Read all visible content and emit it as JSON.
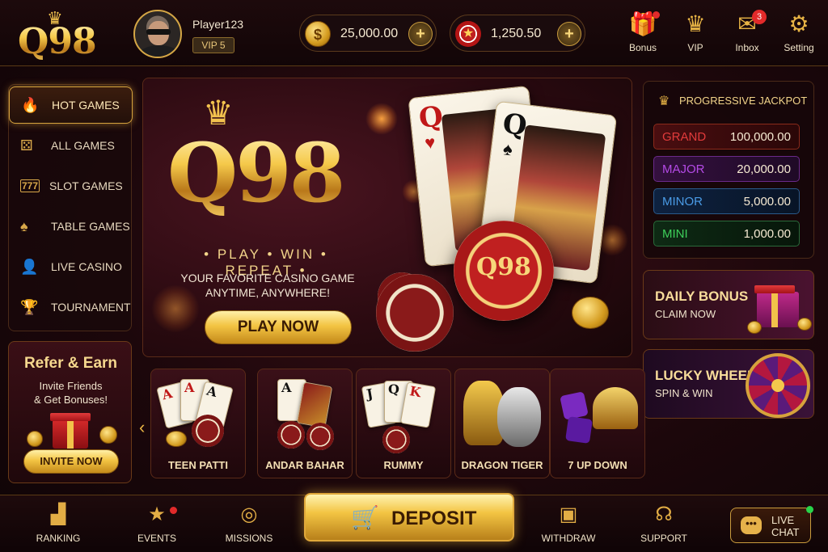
{
  "brand": {
    "logo_text": "Q98"
  },
  "player": {
    "name": "Player123",
    "vip": "VIP 5"
  },
  "wallet": {
    "coins": "25,000.00",
    "chips": "1,250.50",
    "coin_symbol": "$",
    "plus": "+"
  },
  "header_nav": [
    {
      "label": "Bonus",
      "icon": "gift-icon",
      "glyph": "🎁"
    },
    {
      "label": "VIP",
      "icon": "crown-icon",
      "glyph": "♛"
    },
    {
      "label": "Inbox",
      "icon": "mail-icon",
      "glyph": "✉",
      "badge": "3"
    },
    {
      "label": "Setting",
      "icon": "gear-icon",
      "glyph": "⚙"
    }
  ],
  "sidebar": {
    "items": [
      {
        "label": "HOT GAMES",
        "icon": "fire-icon",
        "glyph": "🔥",
        "active": true
      },
      {
        "label": "ALL GAMES",
        "icon": "dice-icon",
        "glyph": "⚄"
      },
      {
        "label": "SLOT GAMES",
        "icon": "slot-777-icon",
        "glyph": "7"
      },
      {
        "label": "TABLE GAMES",
        "icon": "spade-icon",
        "glyph": "♠"
      },
      {
        "label": "LIVE CASINO",
        "icon": "dealer-icon",
        "glyph": "👤"
      },
      {
        "label": "TOURNAMENT",
        "icon": "trophy-icon",
        "glyph": "🏆"
      }
    ]
  },
  "refer": {
    "title": "Refer & Earn",
    "line1": "Invite Friends",
    "line2": "& Get Bonuses!",
    "button": "INVITE NOW"
  },
  "hero": {
    "logo": "Q98",
    "tagline": "• PLAY • WIN • REPEAT •",
    "subtitle_1": "YOUR FAVORITE CASINO GAME",
    "subtitle_2": "ANYTIME, ANYWHERE!",
    "button": "PLAY NOW",
    "card_rank": "Q",
    "chip_text": "Q98"
  },
  "jackpot": {
    "title": "PROGRESSIVE JACKPOT",
    "tiers": [
      {
        "name": "GRAND",
        "value": "100,000.00",
        "color": "#e23b3b"
      },
      {
        "name": "MAJOR",
        "value": "20,000.00",
        "color": "#b44ae6"
      },
      {
        "name": "MINOR",
        "value": "5,000.00",
        "color": "#4a9be6"
      },
      {
        "name": "MINI",
        "value": "1,000.00",
        "color": "#3ecf5a"
      }
    ]
  },
  "promos": {
    "daily": {
      "title": "DAILY BONUS",
      "sub": "CLAIM NOW"
    },
    "wheel": {
      "title": "LUCKY WHEEL",
      "sub": "SPIN & WIN"
    }
  },
  "games": [
    {
      "label": "TEEN PATTI"
    },
    {
      "label": "ANDAR BAHAR"
    },
    {
      "label": "RUMMY"
    },
    {
      "label": "DRAGON TIGER"
    },
    {
      "label": "7 UP DOWN"
    }
  ],
  "bottom_nav": [
    {
      "label": "RANKING",
      "icon": "podium-icon",
      "glyph": "▟"
    },
    {
      "label": "EVENTS",
      "icon": "calendar-star-icon",
      "glyph": "★"
    },
    {
      "label": "MISSIONS",
      "icon": "target-icon",
      "glyph": "◎"
    },
    {
      "label": "WITHDRAW",
      "icon": "wallet-icon",
      "glyph": "▣"
    },
    {
      "label": "SUPPORT",
      "icon": "headset-icon",
      "glyph": "☊"
    }
  ],
  "deposit": {
    "label": "DEPOSIT",
    "icon": "cart-icon",
    "glyph": "🛒"
  },
  "live_chat": {
    "line1": "LIVE",
    "line2": "CHAT",
    "glyph": "•••"
  },
  "colors": {
    "accent_gold": "#f3c443",
    "background": "#1c070b"
  }
}
